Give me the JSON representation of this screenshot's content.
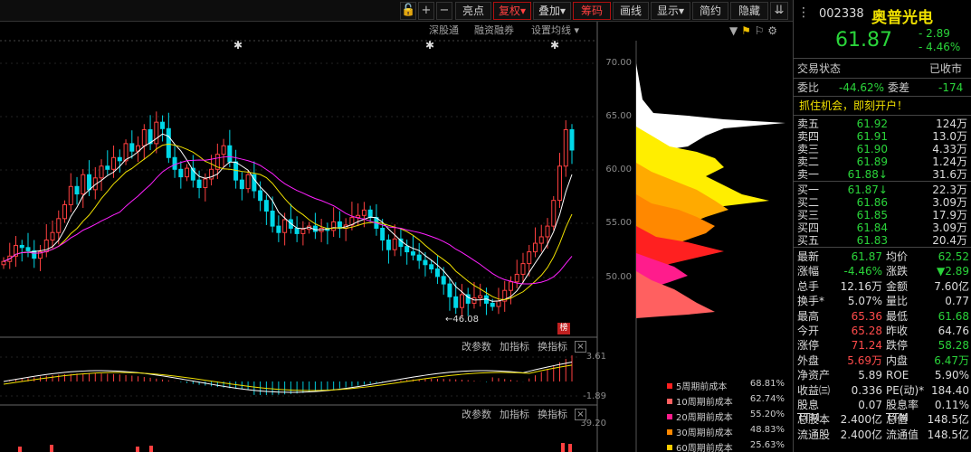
{
  "toolbar": {
    "buttons": [
      "亮点",
      "复权",
      "叠加",
      "筹码",
      "画线",
      "显示",
      "简约",
      "隐藏"
    ],
    "icons": [
      "lock-icon",
      "plus-icon",
      "minus-icon"
    ]
  },
  "subbar": {
    "shenguto": "深股通",
    "rongzi": "融资融券",
    "settings": "设置均线"
  },
  "axis": {
    "main": [
      "70.00",
      "65.00",
      "60.00",
      "55.00",
      "50.00"
    ],
    "ind1_top": "3.61",
    "ind1_bot": "-1.89",
    "ind2_top": "39.20"
  },
  "marks": {
    "low_label": "46.08",
    "bang": "榜"
  },
  "indicator_bar": {
    "params": "改参数",
    "add": "加指标",
    "switch": "换指标",
    "close": "×"
  },
  "legend": [
    {
      "label": "5周期前成本",
      "pct": "68.81%",
      "color": "#ff2020"
    },
    {
      "label": "10周期前成本",
      "pct": "62.74%",
      "color": "#ff6060"
    },
    {
      "label": "20周期前成本",
      "pct": "55.20%",
      "color": "#ff1c8c"
    },
    {
      "label": "30周期前成本",
      "pct": "48.83%",
      "color": "#ff8800"
    },
    {
      "label": "60周期前成本",
      "pct": "25.63%",
      "color": "#ffcc00"
    }
  ],
  "stock": {
    "code": "002338",
    "name": "奥普光电",
    "price": "61.87",
    "change": "- 2.89",
    "pct": "- 4.46%",
    "status_label": "交易状态",
    "status": "已收市",
    "weibi_label": "委比",
    "weibi": "-44.62%",
    "weicha_label": "委差",
    "weicha": "-174",
    "banner": "抓住机会，即刻开户！"
  },
  "asks": [
    {
      "label": "卖五",
      "price": "61.92",
      "vol": "124万"
    },
    {
      "label": "卖四",
      "price": "61.91",
      "vol": "13.0万"
    },
    {
      "label": "卖三",
      "price": "61.90",
      "vol": "4.33万"
    },
    {
      "label": "卖二",
      "price": "61.89",
      "vol": "1.24万"
    },
    {
      "label": "卖一",
      "price": "61.88↓",
      "vol": "31.6万"
    }
  ],
  "bids": [
    {
      "label": "买一",
      "price": "61.87↓",
      "vol": "22.3万"
    },
    {
      "label": "买二",
      "price": "61.86",
      "vol": "3.09万"
    },
    {
      "label": "买三",
      "price": "61.85",
      "vol": "17.9万"
    },
    {
      "label": "买四",
      "price": "61.84",
      "vol": "3.09万"
    },
    {
      "label": "买五",
      "price": "61.83",
      "vol": "20.4万"
    }
  ],
  "stats": [
    {
      "l1": "最新",
      "v1": "61.87",
      "c1": "grn",
      "l2": "均价",
      "v2": "62.52",
      "c2": "grn"
    },
    {
      "l1": "涨幅",
      "v1": "-4.46%",
      "c1": "grn",
      "l2": "涨跌",
      "v2": "▼2.89",
      "c2": "grn"
    },
    {
      "l1": "总手",
      "v1": "12.16万",
      "c1": "wht",
      "l2": "金额",
      "v2": "7.60亿",
      "c2": "wht"
    },
    {
      "l1": "换手*",
      "v1": "5.07%",
      "c1": "wht",
      "l2": "量比",
      "v2": "0.77",
      "c2": "wht"
    },
    {
      "l1": "最高",
      "v1": "65.36",
      "c1": "red",
      "l2": "最低",
      "v2": "61.68",
      "c2": "grn"
    },
    {
      "l1": "今开",
      "v1": "65.28",
      "c1": "red",
      "l2": "昨收",
      "v2": "64.76",
      "c2": "wht"
    },
    {
      "l1": "涨停",
      "v1": "71.24",
      "c1": "red",
      "l2": "跌停",
      "v2": "58.28",
      "c2": "grn"
    },
    {
      "l1": "外盘",
      "v1": "5.69万",
      "c1": "red",
      "l2": "内盘",
      "v2": "6.47万",
      "c2": "grn"
    },
    {
      "l1": "净资产",
      "v1": "5.89",
      "c1": "wht",
      "l2": "ROE",
      "v2": "5.90%",
      "c2": "wht"
    },
    {
      "l1": "收益㈢",
      "v1": "0.336",
      "c1": "wht",
      "l2": "PE(动)*",
      "v2": "184.40",
      "c2": "wht"
    },
    {
      "l1": "股息TTM",
      "v1": "0.07",
      "c1": "wht",
      "l2": "股息率TTM",
      "v2": "0.11%",
      "c2": "wht"
    },
    {
      "l1": "总股本",
      "v1": "2.400亿",
      "c1": "wht",
      "l2": "总值",
      "v2": "148.5亿",
      "c2": "wht"
    },
    {
      "l1": "流通股",
      "v1": "2.400亿",
      "c1": "wht",
      "l2": "流通值",
      "v2": "148.5亿",
      "c2": "wht"
    }
  ]
}
